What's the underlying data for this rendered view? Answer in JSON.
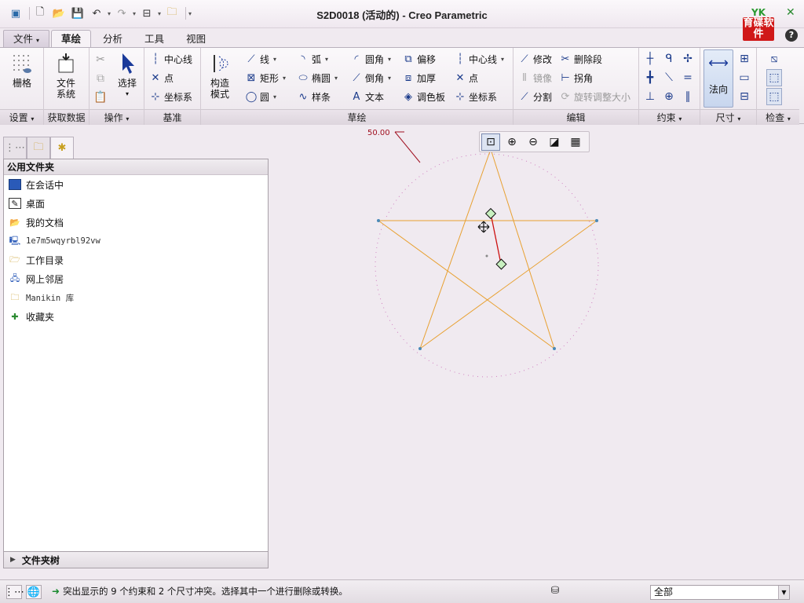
{
  "window": {
    "title": "S2D0018 (活动的) - Creo Parametric",
    "logo_text_top": "YK",
    "logo_text": "育碟软件"
  },
  "menu_tabs": [
    {
      "label": "文件",
      "arrow": "▾"
    },
    {
      "label": "草绘"
    },
    {
      "label": "分析"
    },
    {
      "label": "工具"
    },
    {
      "label": "视图"
    }
  ],
  "ribbon": {
    "setup": {
      "grid": "栅格",
      "label": "设置"
    },
    "get_data": {
      "file_system": "文件系统",
      "label": "获取数据"
    },
    "operations": {
      "select": "选择",
      "label": "操作"
    },
    "datum": {
      "centerline": "中心线",
      "point": "点",
      "coord_sys": "坐标系",
      "label": "基准"
    },
    "sketch": {
      "construction_mode": "构造模式",
      "line": "线",
      "rectangle": "矩形",
      "circle": "圆",
      "arc": "弧",
      "ellipse": "椭圆",
      "spline": "样条",
      "fillet": "圆角",
      "chamfer": "倒角",
      "text": "文本",
      "offset": "偏移",
      "thicken": "加厚",
      "palette": "调色板",
      "centerline": "中心线",
      "point": "点",
      "coord_sys": "坐标系",
      "label": "草绘"
    },
    "edit": {
      "modify": "修改",
      "delete_segment": "删除段",
      "mirror": "镜像",
      "corner": "拐角",
      "divide": "分割",
      "rotate_resize": "旋转调整大小",
      "label": "编辑"
    },
    "constrain": {
      "label": "约束"
    },
    "dimension": {
      "normal": "法向",
      "label": "尺寸"
    },
    "inspect": {
      "label": "检查"
    }
  },
  "folder_panel": {
    "header": "公用文件夹",
    "items": [
      {
        "label": "在会话中",
        "icon": "monitor-icon"
      },
      {
        "label": "桌面",
        "icon": "desktop-icon"
      },
      {
        "label": "我的文档",
        "icon": "documents-folder-icon"
      },
      {
        "label": "1e7m5wqyrbl92vw",
        "icon": "computer-icon"
      },
      {
        "label": "工作目录",
        "icon": "working-directory-icon"
      },
      {
        "label": "网上邻居",
        "icon": "network-icon"
      },
      {
        "label": "Manikin 库",
        "icon": "library-folder-icon"
      },
      {
        "label": "收藏夹",
        "icon": "favorites-icon"
      }
    ],
    "tree_label": "文件夹树"
  },
  "canvas": {
    "dimension_label": "50.00",
    "accent_line": "#e8a030",
    "constraint_color": "#cc1010"
  },
  "status": {
    "message": "突出显示的 9 个约束和 2 个尺寸冲突。选择其中一个进行删除或转换。",
    "filter_value": "全部"
  }
}
